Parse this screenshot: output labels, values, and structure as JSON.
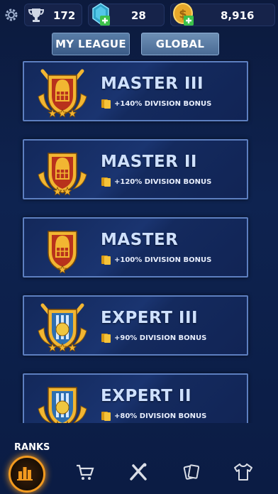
{
  "header": {
    "trophies": "172",
    "gems": "28",
    "coins": "8,916",
    "icons": [
      "gear-icon",
      "trophy-icon",
      "gem-icon",
      "coin-icon",
      "plus-icon"
    ]
  },
  "tabs": [
    {
      "label": "MY LEAGUE"
    },
    {
      "label": "GLOBAL"
    }
  ],
  "divisions": [
    {
      "title": "MASTER III",
      "bonus": "+140% DIVISION BONUS",
      "stars": 3,
      "tier": "master"
    },
    {
      "title": "MASTER II",
      "bonus": "+120% DIVISION BONUS",
      "stars": 2,
      "tier": "master"
    },
    {
      "title": "MASTER",
      "bonus": "+100% DIVISION BONUS",
      "stars": 1,
      "tier": "master"
    },
    {
      "title": "EXPERT III",
      "bonus": "+90% DIVISION BONUS",
      "stars": 3,
      "tier": "expert"
    },
    {
      "title": "EXPERT II",
      "bonus": "+80% DIVISION BONUS",
      "stars": 2,
      "tier": "expert"
    }
  ],
  "bottom_nav": {
    "active_label": "RANKS",
    "items": [
      "ranks-icon",
      "cart-icon",
      "crossed-bats-icon",
      "cards-icon",
      "jersey-icon"
    ]
  },
  "colors": {
    "accent": "#f29a1f",
    "card_border": "#5d7fc0",
    "title_text": "#cfe1ff",
    "gold": "#f2b632"
  }
}
